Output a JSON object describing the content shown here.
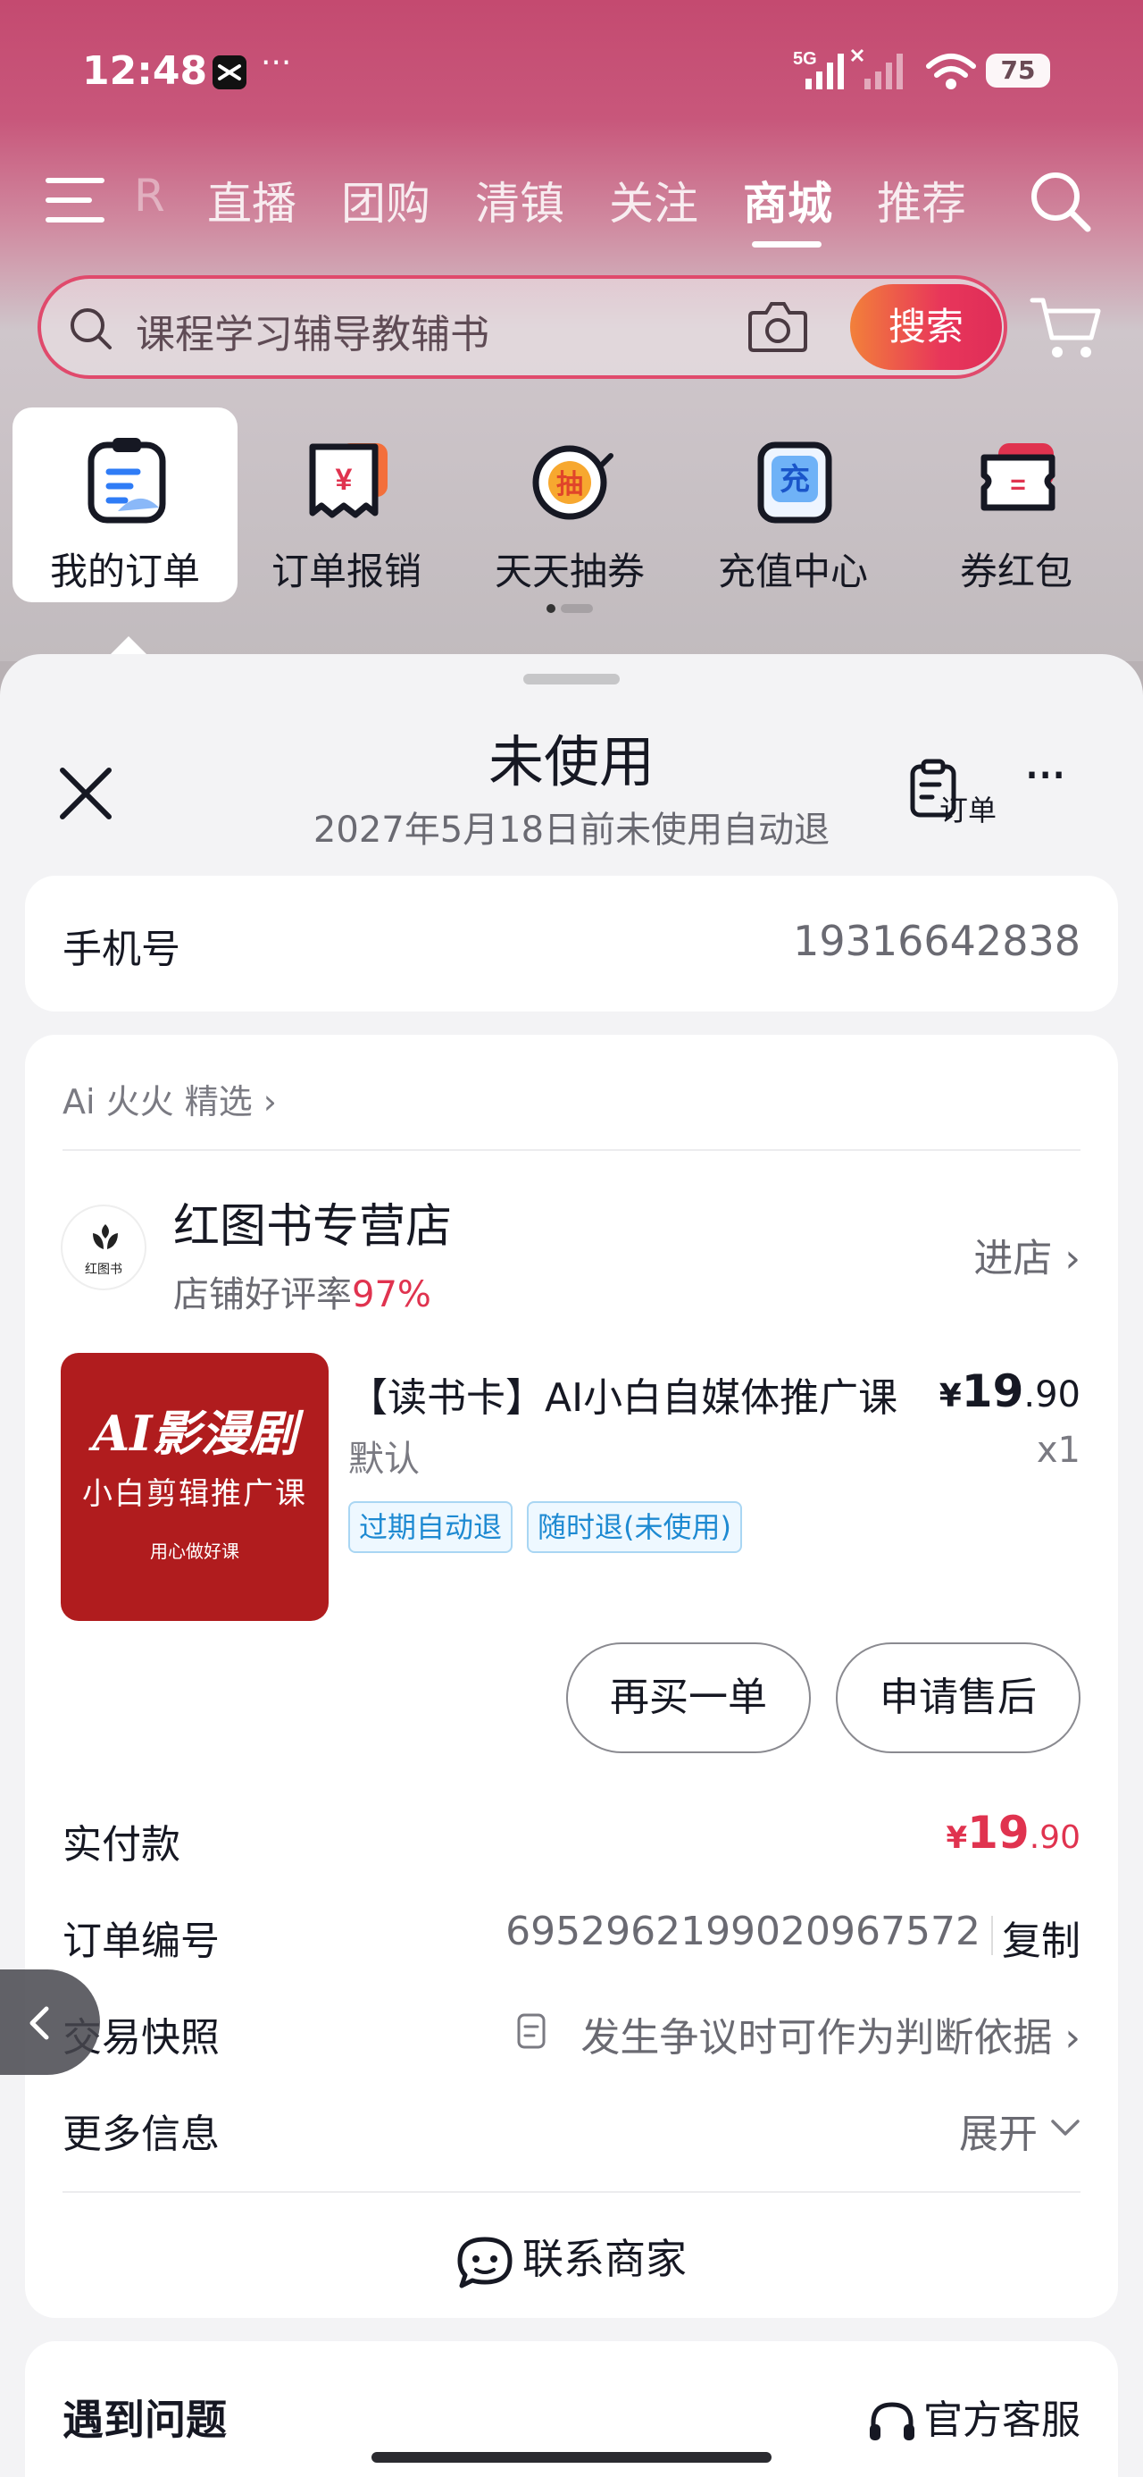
{
  "status_bar": {
    "time": "12:48",
    "more": "···",
    "network": "5G",
    "battery": "75"
  },
  "nav": {
    "ghost": "R",
    "tabs": [
      "直播",
      "团购",
      "清镇",
      "关注",
      "商城",
      "推荐"
    ],
    "active_tab": "商城"
  },
  "search": {
    "placeholder": "课程学习辅导教辅书",
    "button": "搜索"
  },
  "shortcuts": [
    "我的订单",
    "订单报销",
    "天天抽券",
    "充值中心",
    "券红包"
  ],
  "shortcut_glyphs": {
    "reimburse": "¥",
    "lottery": "抽",
    "recharge": "充",
    "coupon": "="
  },
  "sheet": {
    "title": "未使用",
    "subtitle": "2027年5月18日前未使用自动退",
    "order_label": "订单",
    "more": "···"
  },
  "phone": {
    "label": "手机号",
    "value": "19316642838"
  },
  "order": {
    "source": "Ai 火火 精选 ›",
    "shop": {
      "logo_text": "红图书",
      "name": "红图书专营店",
      "rating_label": "店铺好评率",
      "rating_value": "97%",
      "enter": "进店 ›"
    },
    "product": {
      "image_title": "AI影漫剧",
      "image_subtitle": "小白剪辑推广课",
      "image_slogan": "用心做好课",
      "title": "【读书卡】AI小白自媒体推广课",
      "price_symbol": "¥",
      "price_int": "19",
      "price_dec": ".90",
      "spec": "默认",
      "qty": "x1",
      "tags": [
        "过期自动退",
        "随时退(未使用)"
      ]
    },
    "buttons": {
      "rebuy": "再买一单",
      "aftersale": "申请售后"
    },
    "paid": {
      "label": "实付款",
      "symbol": "¥",
      "int": "19",
      "dec": ".90"
    },
    "order_no": {
      "label": "订单编号",
      "value": "6952962199020967572",
      "copy": "复制"
    },
    "snapshot": {
      "label": "交易快照",
      "value": "发生争议时可作为判断依据 ›"
    },
    "more_info": {
      "label": "更多信息",
      "value": "展开"
    },
    "contact": "联系商家"
  },
  "issue": {
    "label": "遇到问题",
    "service": "官方客服"
  },
  "colors": {
    "accent": "#e0334f",
    "brand_red": "#df2d58",
    "tag_blue": "#1e8ad2"
  }
}
